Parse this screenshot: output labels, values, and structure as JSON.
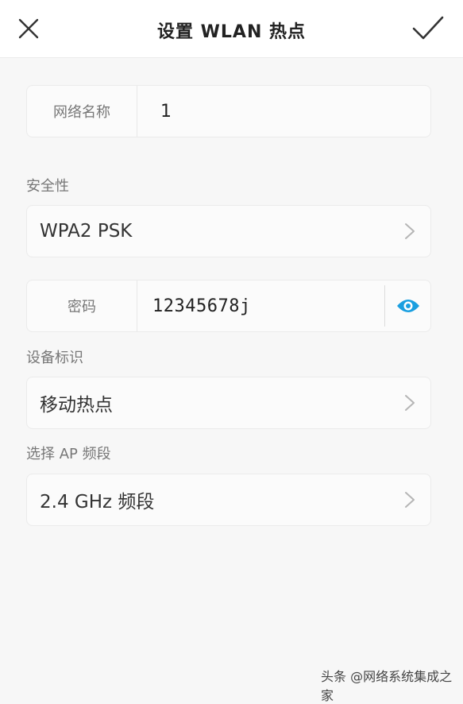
{
  "header": {
    "title": "设置 WLAN 热点",
    "close_icon": "close-icon",
    "confirm_icon": "checkmark-icon"
  },
  "ssid": {
    "label": "网络名称",
    "value": "1"
  },
  "security": {
    "section_label": "安全性",
    "value": "WPA2 PSK"
  },
  "password": {
    "label": "密码",
    "value": "12345678j",
    "toggle_icon": "eye-icon"
  },
  "device_id": {
    "section_label": "设备标识",
    "value": "移动热点"
  },
  "ap_band": {
    "section_label": "选择 AP 频段",
    "value": "2.4 GHz 频段"
  },
  "watermark": "头条 @网络系统集成之家",
  "colors": {
    "accent": "#1a9fe0",
    "background": "#f7f7f7",
    "card": "#fbfbfb"
  }
}
